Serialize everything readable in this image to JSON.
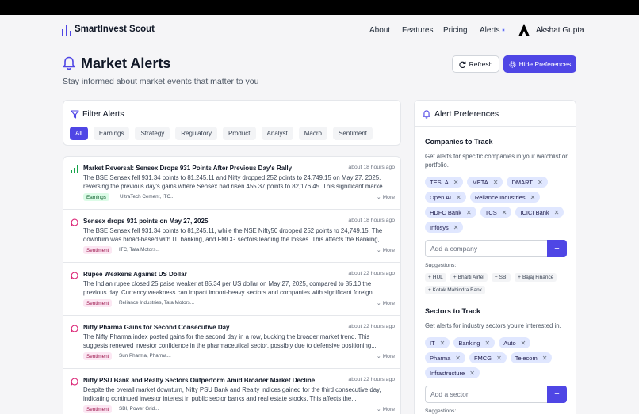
{
  "app": {
    "title": "SmartInvest Scout"
  },
  "nav": {
    "about": "About",
    "features": "Features",
    "pricing": "Pricing",
    "alerts": "Alerts",
    "user_name": "Akshat Gupta"
  },
  "page": {
    "title": "Market Alerts",
    "subtitle": "Stay informed about market events that matter to you",
    "refresh_label": "Refresh",
    "hide_label": "Hide Preferences"
  },
  "filter": {
    "title": "Filter Alerts",
    "chips": [
      "All",
      "Earnings",
      "Strategy",
      "Regulatory",
      "Product",
      "Analyst",
      "Macro",
      "Sentiment"
    ],
    "active": "All"
  },
  "alerts": [
    {
      "icon": "trending-up-icon",
      "title": "Market Reversal: Sensex Drops 931 Points After Previous Day's Rally",
      "time": "about 18 hours ago",
      "body": "The BSE Sensex fell 931.34 points to 81,245.11 and Nifty dropped 252 points to 24,749.15 on May 27, 2025, reversing the previous day's gains where Sensex had risen 455.37 points to 82,176.45. This significant marke...",
      "tag": "Earnings",
      "tag_color": "green",
      "companies": "UltraTech Cement, ITC...",
      "more": "More"
    },
    {
      "icon": "message-icon",
      "title": "Sensex drops 931 points on May 27, 2025",
      "time": "about 18 hours ago",
      "body": "The BSE Sensex fell 931.34 points to 81,245.11, while the NSE Nifty50 dropped 252 points to 24,749.15. The downturn was broad-based with IT, banking, and FMCG sectors leading the losses. This affects the Banking,...",
      "tag": "Sentiment",
      "tag_color": "pink",
      "companies": "ITC, Tata Motors...",
      "more": "More"
    },
    {
      "icon": "message-icon",
      "title": "Rupee Weakens Against US Dollar",
      "time": "about 22 hours ago",
      "body": "The Indian rupee closed 25 paise weaker at 85.34 per US dollar on May 27, 2025, compared to 85.10 the previous day. Currency weakness can impact import-heavy sectors and companies with significant foreign...",
      "tag": "Sentiment",
      "tag_color": "pink",
      "companies": "Reliance Industries, Tata Motors...",
      "more": "More"
    },
    {
      "icon": "message-icon",
      "title": "Nifty Pharma Gains for Second Consecutive Day",
      "time": "about 22 hours ago",
      "body": "The Nifty Pharma index posted gains for the second day in a row, bucking the broader market trend. This suggests renewed investor confidence in the pharmaceutical sector, possibly due to defensive positioning...",
      "tag": "Sentiment",
      "tag_color": "pink",
      "companies": "Sun Pharma, Pharma...",
      "more": "More"
    },
    {
      "icon": "message-icon",
      "title": "Nifty PSU Bank and Realty Sectors Outperform Amid Broader Market Decline",
      "time": "about 22 hours ago",
      "body": "Despite the overall market downturn, Nifty PSU Bank and Realty indices gained for the third consecutive day, indicating continued investor interest in public sector banks and real estate stocks. This affects the...",
      "tag": "Sentiment",
      "tag_color": "pink",
      "companies": "SBI, Power Grid...",
      "more": "More"
    }
  ],
  "preferences": {
    "title": "Alert Preferences",
    "companies": {
      "title": "Companies to Track",
      "desc": "Get alerts for specific companies in your watchlist or portfolio.",
      "items": [
        "TESLA",
        "META",
        "DMART",
        "Open AI",
        "Reliance Industries",
        "HDFC Bank",
        "TCS",
        "ICICI Bank",
        "Infosys"
      ],
      "placeholder": "Add a company",
      "suggestions_label": "Suggestions:",
      "suggestions": [
        "HUL",
        "Bharti Airtel",
        "SBI",
        "Bajaj Finance",
        "Kotak Mahindra Bank"
      ]
    },
    "sectors": {
      "title": "Sectors to Track",
      "desc": "Get alerts for industry sectors you're interested in.",
      "items": [
        "IT",
        "Banking",
        "Auto",
        "Pharma",
        "FMCG",
        "Telecom",
        "Infrastructure"
      ],
      "placeholder": "Add a sector",
      "suggestions_label": "Suggestions:"
    }
  },
  "colors": {
    "accent": "#4f46e5",
    "pill": "#e0e7ff"
  }
}
